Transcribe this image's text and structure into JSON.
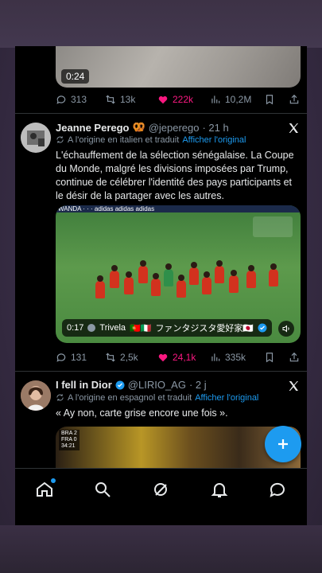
{
  "top_video": {
    "duration": "0:24"
  },
  "top_actions": {
    "replies": "313",
    "retweets": "13k",
    "likes": "222k",
    "views": "10,2M"
  },
  "tweet1": {
    "name": "Jeanne Perego",
    "emoji": "🥨",
    "handle": "@jeperego",
    "time": "· 21 h",
    "translated_note": "A l'origine en italien et traduit",
    "show_original": "Afficher l'original",
    "text": "L'échauffement de la sélection sénégalaise. La Coupe du Monde, malgré les divisions imposées par Trump, continue de célébrer l'identité des pays participants et le désir de la partager avec les autres.",
    "media": {
      "banner": "WANDA ·  ·  ·  adidas  adidas  adidas",
      "time": "0:17",
      "channel": "Trivela",
      "flags": "🇵🇹🇮🇹",
      "caption": "ファンタジスタ愛好家🇯🇵"
    },
    "actions": {
      "replies": "131",
      "retweets": "2,5k",
      "likes": "24,1k",
      "views": "335k"
    }
  },
  "tweet2": {
    "name": "I fell in Dior",
    "handle": "@LIRIO_AG",
    "time": "· 2 j",
    "translated_note": "A l'origine en espagnol et traduit",
    "show_original": "Afficher l'original",
    "text": "« Ay non, carte grise encore une fois ».",
    "score": {
      "team1": "BRA",
      "score1": "2",
      "team2": "FRA",
      "score2": "0",
      "clock": "34:21"
    }
  },
  "colors": {
    "accent": "#1d9bf0",
    "like": "#f91880",
    "muted": "#8b98a5"
  },
  "nav_icons": [
    "home-icon",
    "search-icon",
    "grok-icon",
    "notifications-icon",
    "messages-icon"
  ]
}
